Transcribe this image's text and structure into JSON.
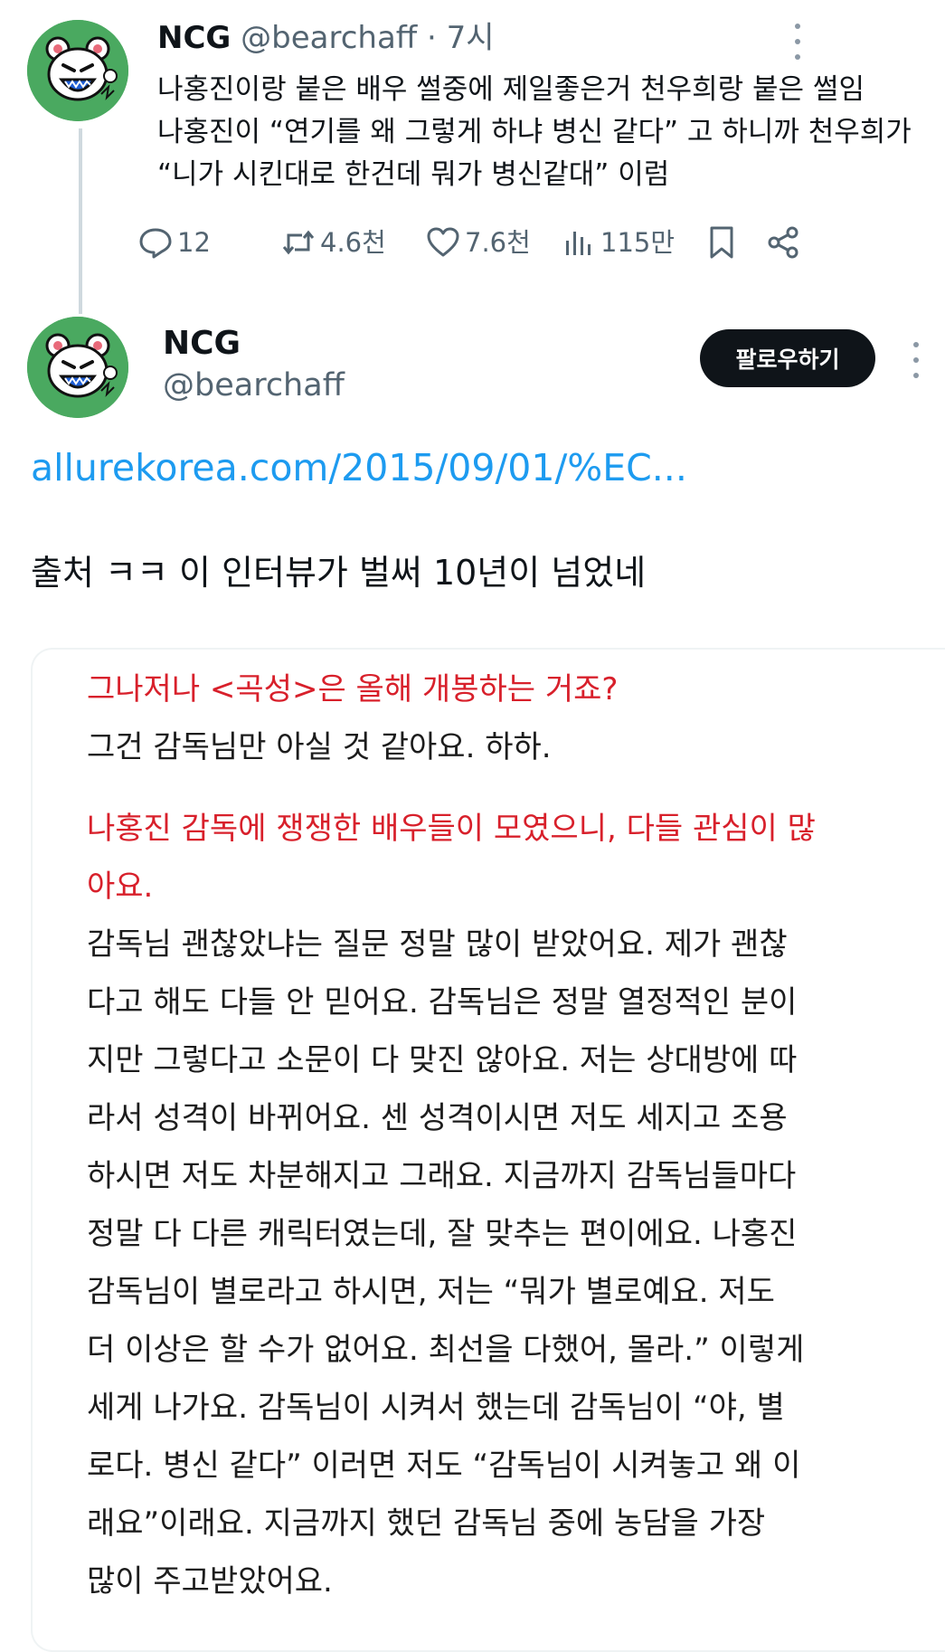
{
  "post1": {
    "author_name": "NCG",
    "handle": "@bearchaff",
    "separator": "·",
    "time": "7시",
    "text_lines": [
      "나홍진이랑 붙은 배우 썰중에 제일좋은거 천우희랑 붙은 썰임",
      "나홍진이 “연기를 왜 그렇게 하냐 병신 같다” 고 하니까 천우희가",
      "“니가 시킨대로 한건데 뭐가 병신같대” 이럼"
    ],
    "actions": {
      "replies": "12",
      "reposts": "4.6천",
      "likes": "7.6천",
      "views": "115만"
    }
  },
  "post2": {
    "author_name": "NCG",
    "handle": "@bearchaff",
    "follow_label": "팔로우하기",
    "link_text": "allurekorea.com/2015/09/01/%EC...",
    "text": "출처 ㅋㅋ 이 인터뷰가 벌써 10년이 넘었네"
  },
  "article": {
    "q1": "그나저나 <곡성>은 올해 개봉하는 거죠?",
    "a1": "그건 감독님만 아실 것 같아요. 하하.",
    "q2_lines": [
      "나홍진 감독에 쟁쟁한 배우들이 모였으니, 다들 관심이 많",
      "아요."
    ],
    "a2_lines": [
      "감독님 괜찮았냐는 질문 정말 많이 받았어요. 제가 괜찮",
      "다고 해도 다들 안 믿어요. 감독님은 정말 열정적인 분이",
      "지만 그렇다고 소문이 다 맞진 않아요. 저는 상대방에 따",
      "라서 성격이 바뀌어요. 센 성격이시면 저도 세지고 조용",
      "하시면 저도 차분해지고 그래요. 지금까지 감독님들마다",
      "정말 다 다른 캐릭터였는데, 잘 맞추는 편이에요. 나홍진",
      "감독님이 별로라고 하시면, 저는 “뭐가 별로예요. 저도",
      "더 이상은 할 수가 없어요. 최선을 다했어, 몰라.” 이렇게",
      "세게 나가요. 감독님이 시켜서 했는데 감독님이 “야, 별",
      "로다. 병신 같다” 이러면 저도 “감독님이 시켜놓고 왜 이",
      "래요”이래요. 지금까지 했던 감독님 중에 농담을 가장",
      "많이 주고받았어요."
    ]
  },
  "icons": {
    "avatar": "cartoon-bear-avatar",
    "more": "more-vertical-icon",
    "reply": "speech-bubble-icon",
    "repost": "repost-arrows-icon",
    "like": "heart-icon",
    "views": "bar-chart-icon",
    "bookmark": "bookmark-icon",
    "share": "share-icon"
  },
  "colors": {
    "link": "#1d9bf0",
    "question": "#d8202b",
    "avatar_bg": "#4aa960",
    "follow_button_bg": "#0f1419"
  }
}
